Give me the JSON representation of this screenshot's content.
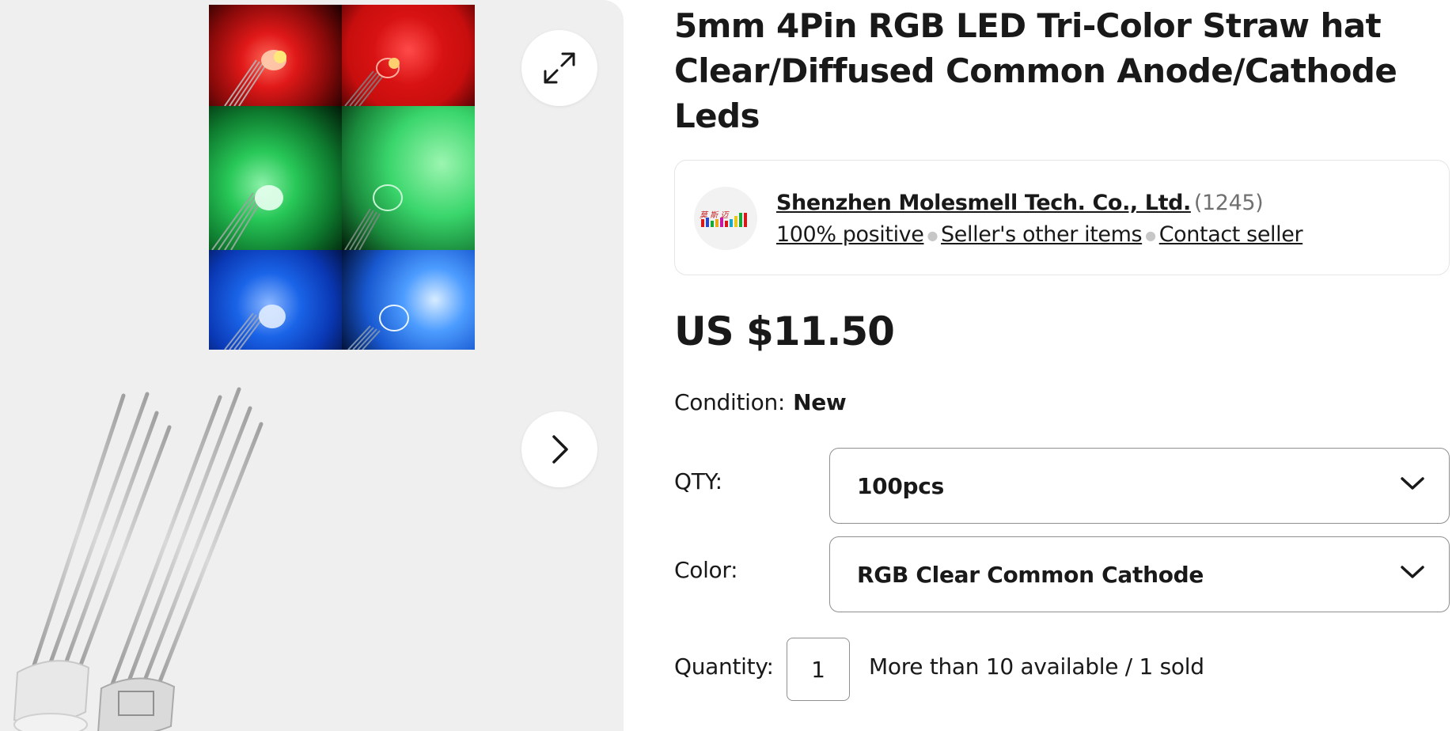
{
  "gallery": {
    "expand_icon": "expand-arrows-icon",
    "next_icon": "chevron-right-icon"
  },
  "listing": {
    "title": "5mm 4Pin RGB LED Tri-Color Straw hat Clear/Diffused Common Anode/Cathode Leds"
  },
  "seller": {
    "name": "Shenzhen Molesmell Tech. Co., Ltd.",
    "feedback_count": "(1245)",
    "positive": "100% positive",
    "other_items": "Seller's other items",
    "contact": "Contact seller"
  },
  "price": "US $11.50",
  "condition": {
    "label": "Condition:",
    "value": "New"
  },
  "qty_select": {
    "label": "QTY:",
    "value": "100pcs"
  },
  "color_select": {
    "label": "Color:",
    "value": "RGB Clear Common Cathode"
  },
  "quantity": {
    "label": "Quantity:",
    "value": "1",
    "availability": "More than 10 available / 1 sold"
  },
  "colors": {
    "text": "#191919",
    "muted": "#707070",
    "border": "#8f8f8f",
    "gallery_bg": "#efefef"
  }
}
